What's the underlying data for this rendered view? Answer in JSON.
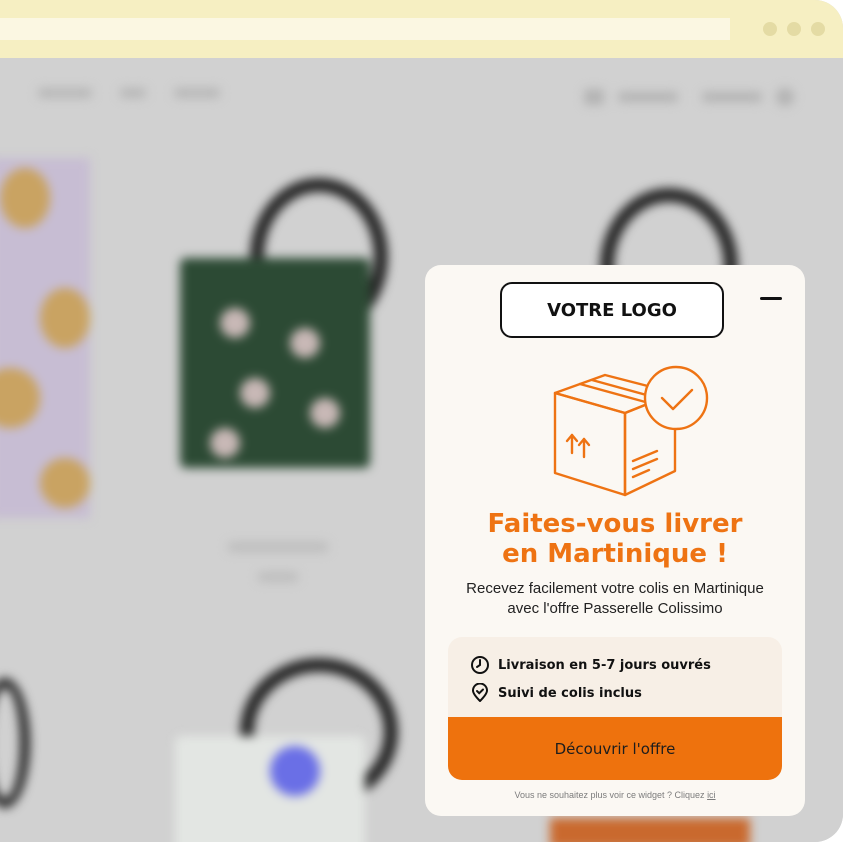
{
  "browser": {
    "window_dots": 3,
    "colors": {
      "topbar": "#f6efc2",
      "dot": "#e4dba4"
    }
  },
  "background_site": {
    "blurred": true,
    "icons": [
      "cart-icon",
      "account-icon"
    ]
  },
  "popup": {
    "logo_label": "VOTRE LOGO",
    "minimize_icon": "minus-icon",
    "hero_icon": "package-delivery-check-icon",
    "title_line1": "Faites-vous livrer",
    "title_line2": "en Martinique !",
    "subtitle_line1": "Recevez facilement votre colis en Martinique",
    "subtitle_line2": "avec l'offre Passerelle Colissimo",
    "features": [
      {
        "icon": "clock-icon",
        "label": "Livraison en 5-7 jours ouvrés"
      },
      {
        "icon": "location-check-icon",
        "label": "Suivi de colis inclus"
      }
    ],
    "cta_label": "Découvrir l'offre",
    "footer_text": "Vous ne souhaitez plus voir ce widget ? Cliquez ",
    "footer_link": "ici",
    "colors": {
      "accent": "#ee7313",
      "card_bg": "#f7efe6",
      "popup_bg": "#fbf8f3"
    }
  }
}
